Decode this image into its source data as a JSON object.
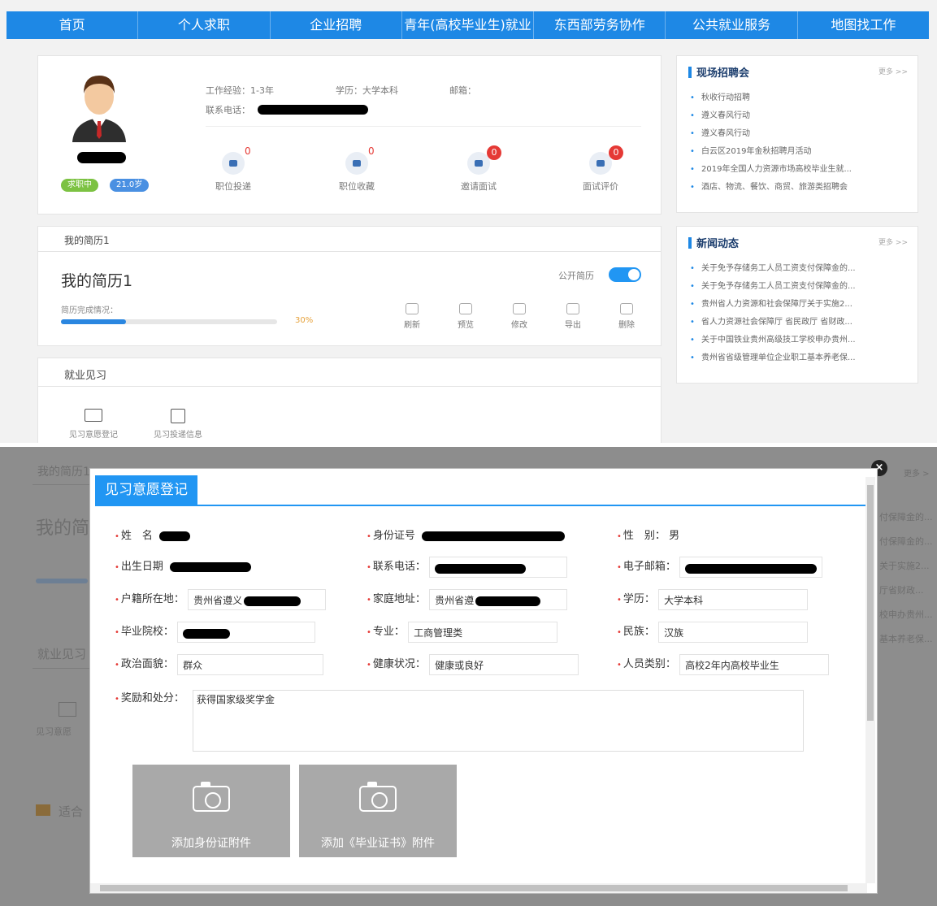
{
  "nav": {
    "items": [
      "首页",
      "个人求职",
      "企业招聘",
      "青年(高校毕业生)就业",
      "东西部劳务协作",
      "公共就业服务",
      "地图找工作"
    ]
  },
  "profile": {
    "experience": "工作经验：1-3年",
    "education": "学历：大学本科",
    "email": "邮箱：",
    "phone_label": "联系电话：",
    "status_badge": "求职中",
    "age_badge": "21.0岁",
    "stats": [
      {
        "label": "职位投递",
        "count": "0"
      },
      {
        "label": "职位收藏",
        "count": "0"
      },
      {
        "label": "邀请面试",
        "count": "0"
      },
      {
        "label": "面试评价",
        "count": "0"
      }
    ]
  },
  "resume": {
    "tab": "我的简历1",
    "title": "我的简历1",
    "public_label": "公开简历",
    "public_on": true,
    "completion_label": "简历完成情况：",
    "completion_text": "30%",
    "completion": 0.3,
    "actions": [
      "刷新",
      "预览",
      "修改",
      "导出",
      "删除"
    ]
  },
  "internship": {
    "title": "就业见习",
    "items": [
      "见习意愿登记",
      "见习投递信息"
    ]
  },
  "side": {
    "fair": {
      "title": "现场招聘会",
      "more": "更多 >>",
      "items": [
        "秋收行动招聘",
        "遵义春风行动",
        "遵义春风行动",
        "白云区2019年金秋招聘月活动",
        "2019年全国人力资源市场高校毕业生就...",
        "酒店、物流、餐饮、商贸、旅游类招聘会"
      ]
    },
    "news": {
      "title": "新闻动态",
      "more": "更多 >>",
      "items": [
        "关于免予存储务工人员工资支付保障金的...",
        "关于免予存储务工人员工资支付保障金的...",
        "贵州省人力资源和社会保障厅关于实施2...",
        "省人力资源社会保障厅 省民政厅 省财政...",
        "关于中国铁业贵州高级技工学校申办贵州...",
        "贵州省省级管理单位企业职工基本养老保..."
      ]
    }
  },
  "background": {
    "resume_tab": "我的简历1",
    "resume_title": "我的简",
    "internship": "就业见习",
    "item": "见习意愿",
    "suitable": "适合",
    "news": "新闻动态",
    "more": "更多 >",
    "side_items": [
      "付保障金的...",
      "付保障金的...",
      "关于实施2...",
      "厅省财政...",
      "校申办贵州...",
      "基本养老保..."
    ]
  },
  "modal": {
    "title": "见习意愿登记",
    "fields": {
      "name_label": "姓　名",
      "id_label": "身份证号",
      "gender_label": "性　别：",
      "gender_value": "男",
      "birth_label": "出生日期",
      "phone_label": "联系电话：",
      "email_label": "电子邮箱：",
      "hukou_label": "户籍所在地：",
      "hukou_value": "贵州省遵义",
      "home_label": "家庭地址：",
      "home_value": "贵州省遵",
      "degree_label": "学历：",
      "degree_value": "大学本科",
      "school_label": "毕业院校：",
      "major_label": "专业：",
      "major_value": "工商管理类",
      "ethnic_label": "民族：",
      "ethnic_value": "汉族",
      "political_label": "政治面貌：",
      "political_value": "群众",
      "health_label": "健康状况：",
      "health_value": "健康或良好",
      "category_label": "人员类别：",
      "category_value": "高校2年内高校毕业生",
      "awards_label": "奖励和处分：",
      "awards_value": "获得国家级奖学金"
    },
    "uploads": [
      "添加身份证附件",
      "添加《毕业证书》附件"
    ]
  }
}
